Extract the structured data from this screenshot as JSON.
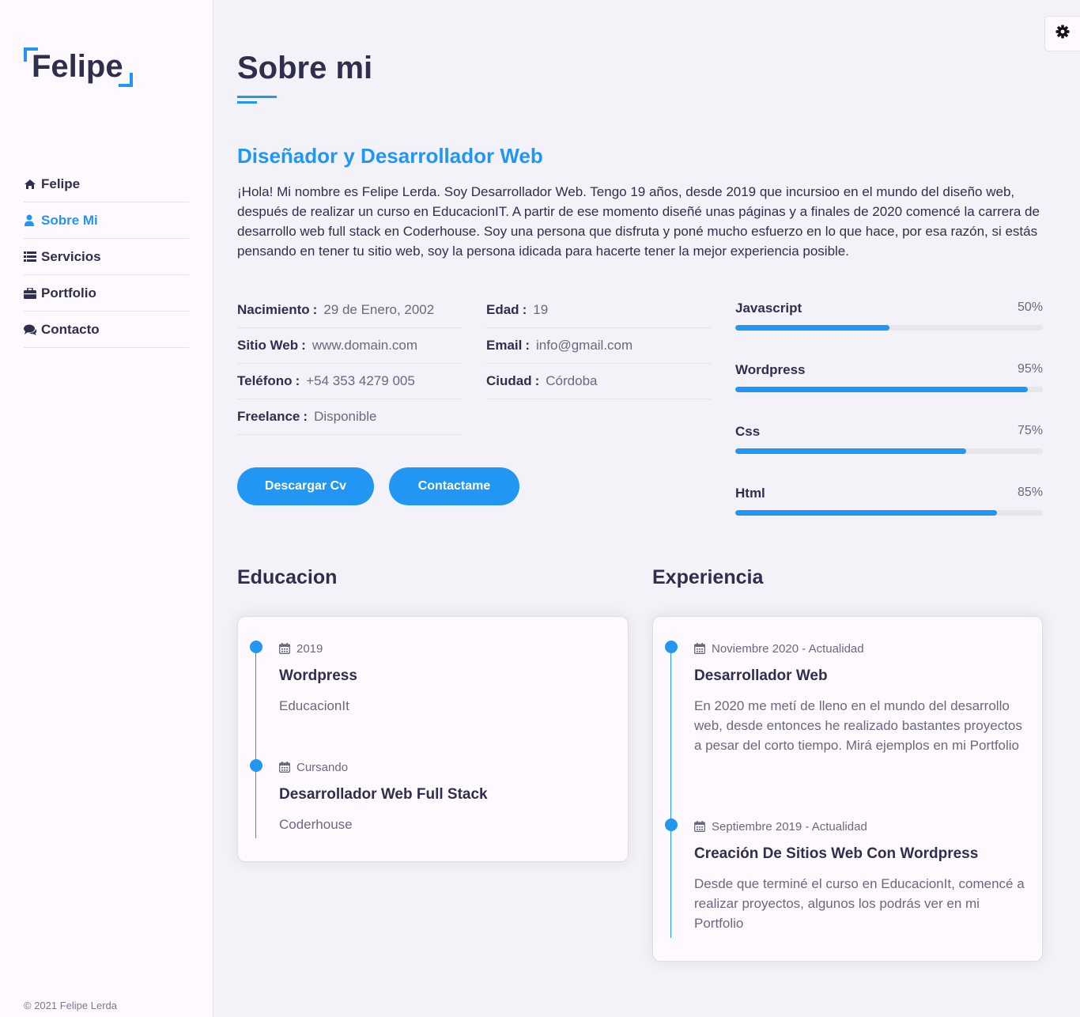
{
  "brand": {
    "name": "Felipe"
  },
  "nav": [
    {
      "label": "Felipe",
      "icon": "home-icon",
      "active": false
    },
    {
      "label": "Sobre Mi",
      "icon": "user-icon",
      "active": true
    },
    {
      "label": "Servicios",
      "icon": "list-icon",
      "active": false
    },
    {
      "label": "Portfolio",
      "icon": "briefcase-icon",
      "active": false
    },
    {
      "label": "Contacto",
      "icon": "comments-icon",
      "active": false
    }
  ],
  "footer": "© 2021 Felipe Lerda",
  "settings_icon": "gear-icon",
  "page": {
    "title": "Sobre mi",
    "subtitle": "Diseñador y Desarrollador Web",
    "intro": "¡Hola! Mi nombre es Felipe Lerda. Soy Desarrollador Web. Tengo 19 años, desde 2019 que incursioo en el mundo del diseño web, después de realizar un curso en EducacionIT. A partir de ese momento diseñé unas páginas y a finales de 2020 comencé la carrera de desarrollo web full stack en Coderhouse. Soy una persona que disfruta y poné mucho esfuerzo en lo que hace, por esa razón, si estás pensando en tener tu sitio web, soy la persona idicada para hacerte tener la mejor experiencia posible."
  },
  "info_left": [
    {
      "label": "Nacimiento",
      "value": "29 de Enero, 2002"
    },
    {
      "label": "Sitio Web",
      "value": "www.domain.com"
    },
    {
      "label": "Teléfono",
      "value": "+54 353 4279 005"
    },
    {
      "label": "Freelance",
      "value": "Disponible"
    }
  ],
  "info_right": [
    {
      "label": "Edad",
      "value": "19"
    },
    {
      "label": "Email",
      "value": "info@gmail.com"
    },
    {
      "label": "Ciudad",
      "value": "Córdoba"
    }
  ],
  "buttons": {
    "cv": "Descargar Cv",
    "contact": "Contactame"
  },
  "skills": [
    {
      "name": "Javascript",
      "percent_label": "50%",
      "level": 0.5
    },
    {
      "name": "Wordpress",
      "percent_label": "95%",
      "level": 0.95
    },
    {
      "name": "Css",
      "percent_label": "75%",
      "level": 0.75
    },
    {
      "name": "Html",
      "percent_label": "85%",
      "level": 0.85
    }
  ],
  "education": {
    "title": "Educacion",
    "items": [
      {
        "date": "2019",
        "title": "Wordpress",
        "desc": "EducacionIt"
      },
      {
        "date": "Cursando",
        "title": "Desarrollador Web Full Stack",
        "desc": "Coderhouse"
      }
    ]
  },
  "experience": {
    "title": "Experiencia",
    "items": [
      {
        "date": "Noviembre 2020 - Actualidad",
        "title": "Desarrollador Web",
        "desc": "En 2020 me metí de lleno en el mundo del desarrollo web, desde entonces he realizado bastantes proyectos a pesar del corto tiempo. Mirá ejemplos en mi Portfolio"
      },
      {
        "date": "Septiembre 2019 - Actualidad",
        "title": "Creación De Sitios Web Con Wordpress",
        "desc": "Desde que terminé el curso en EducacionIt, comencé a realizar proyectos, algunos los podrás ver en mi Portfolio"
      }
    ]
  },
  "colors": {
    "accent": "#2196f3",
    "text": "#302e4d",
    "muted": "#6a6880",
    "background": "#f3f2f8",
    "panel": "#fdf9ff"
  }
}
